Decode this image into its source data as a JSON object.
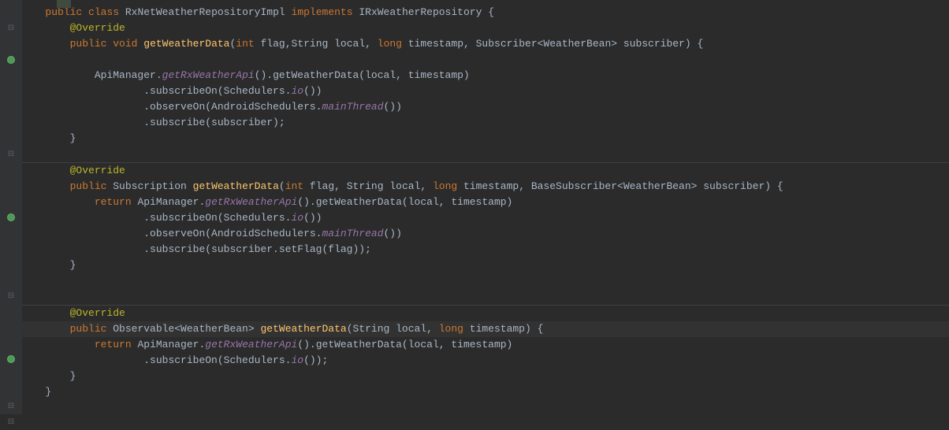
{
  "code": {
    "line1": {
      "kw1": "public",
      "kw2": "class",
      "classname": "RxNetWeatherRepositoryImpl",
      "impl": "implements",
      "iface": "IRxWeatherRepository",
      "brace": "{"
    },
    "line2": {
      "anno": "@Override"
    },
    "line3": {
      "kw1": "public",
      "kw2": "void",
      "method": "getWeatherData",
      "p1type": "int",
      "p1": "flag,String local,",
      "p2type": "long",
      "p2": "timestamp, Subscriber<WeatherBean> subscriber) {"
    },
    "line5": {
      "text1": "ApiManager.",
      "method1": "getRxWeatherApi",
      "text2": "().getWeatherData(local, timestamp)"
    },
    "line6": {
      "text1": ".subscribeOn(Schedulers.",
      "method1": "io",
      "text2": "())"
    },
    "line7": {
      "text1": ".observeOn(AndroidSchedulers.",
      "method1": "mainThread",
      "text2": "())"
    },
    "line8": {
      "text1": ".subscribe(subscriber);"
    },
    "line9": {
      "brace": "}"
    },
    "line11": {
      "anno": "@Override"
    },
    "line12": {
      "kw1": "public",
      "type": "Subscription",
      "method": "getWeatherData",
      "p1type": "int",
      "p1": "flag, String local,",
      "p2type": "long",
      "p2": "timestamp, BaseSubscriber<WeatherBean> subscriber) {"
    },
    "line13": {
      "kw": "return",
      "text1": "ApiManager.",
      "method1": "getRxWeatherApi",
      "text2": "().getWeatherData(local, timestamp)"
    },
    "line14": {
      "text1": ".subscribeOn(Schedulers.",
      "method1": "io",
      "text2": "())"
    },
    "line15": {
      "text1": ".observeOn(AndroidSchedulers.",
      "method1": "mainThread",
      "text2": "())"
    },
    "line16": {
      "text1": ".subscribe(subscriber.setFlag(flag));"
    },
    "line17": {
      "brace": "}"
    },
    "line19": {
      "anno": "@Override"
    },
    "line20": {
      "kw1": "public",
      "type": "Observable<WeatherBean>",
      "method": "getWeatherData",
      "p1": "(String local,",
      "p2type": "long",
      "p2": "timestamp) {"
    },
    "line21": {
      "kw": "return",
      "text1": "ApiManager.",
      "method1": "getRxWeatherApi",
      "text2": "().getWeatherData(local, timestamp)"
    },
    "line22": {
      "text1": ".subscribeOn(Schedulers.",
      "method1": "io",
      "text2": "());"
    },
    "line23": {
      "brace": "}"
    },
    "line24": {
      "brace": "}"
    }
  }
}
